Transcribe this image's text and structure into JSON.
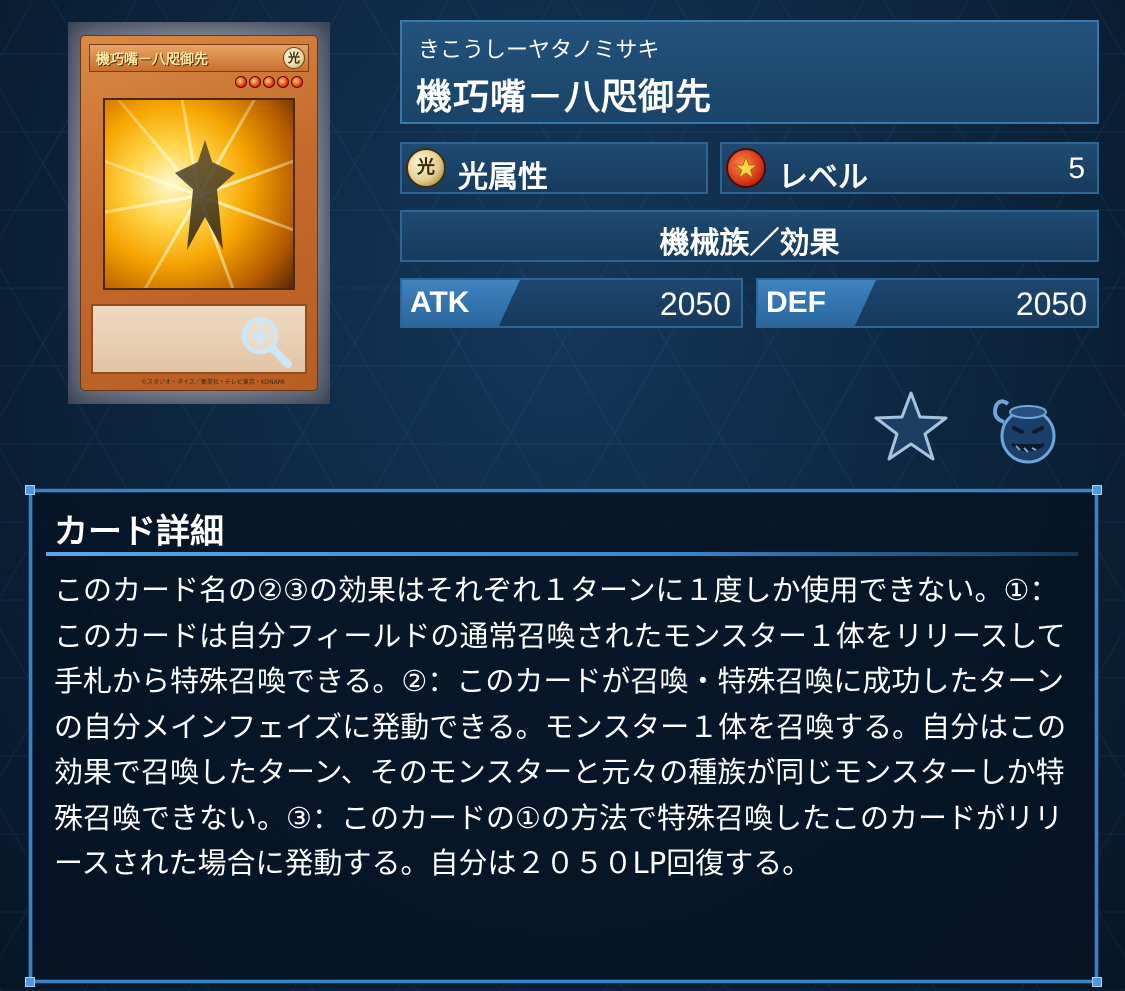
{
  "card": {
    "name_reading": "きこうしーヤタノミサキ",
    "name": "機巧嘴－八咫御先",
    "card_face_name": "機巧嘴－八咫御先",
    "card_face_attribute": "光",
    "card_copyright": "©スタジオ・ダイス／集英社・テレビ東京・KONAMI",
    "attribute_icon_glyph": "光",
    "attribute": "光属性",
    "level_label": "レベル",
    "level": "5",
    "type_line": "機械族／効果",
    "atk_label": "ATK",
    "atk": "2050",
    "def_label": "DEF",
    "def": "2050"
  },
  "details": {
    "title": "カード詳細",
    "text": "このカード名の②③の効果はそれぞれ１ターンに１度しか使用できない。①：このカードは自分フィールドの通常召喚されたモンスター１体をリリースして手札から特殊召喚できる。②：このカードが召喚・特殊召喚に成功したターンの自分メインフェイズに発動できる。モンスター１体を召喚する。自分はこの効果で召喚したターン、そのモンスターと元々の種族が同じモンスターしか特殊召喚できない。③：このカードの①の方法で特殊召喚したこのカードがリリースされた場合に発動する。自分は２０５０LP回復する。"
  },
  "icons": {
    "zoom": "zoom-in-icon",
    "favorite": "star-icon",
    "deck": "pot-of-greed-icon",
    "level": "level-star-icon",
    "attribute": "light-attribute-icon"
  },
  "colors": {
    "panel_border": "#3a82c4",
    "panel_bg": "#1f4a72",
    "atk_def_tag": "#3f83bf",
    "card_frame": "#c46a2c"
  }
}
